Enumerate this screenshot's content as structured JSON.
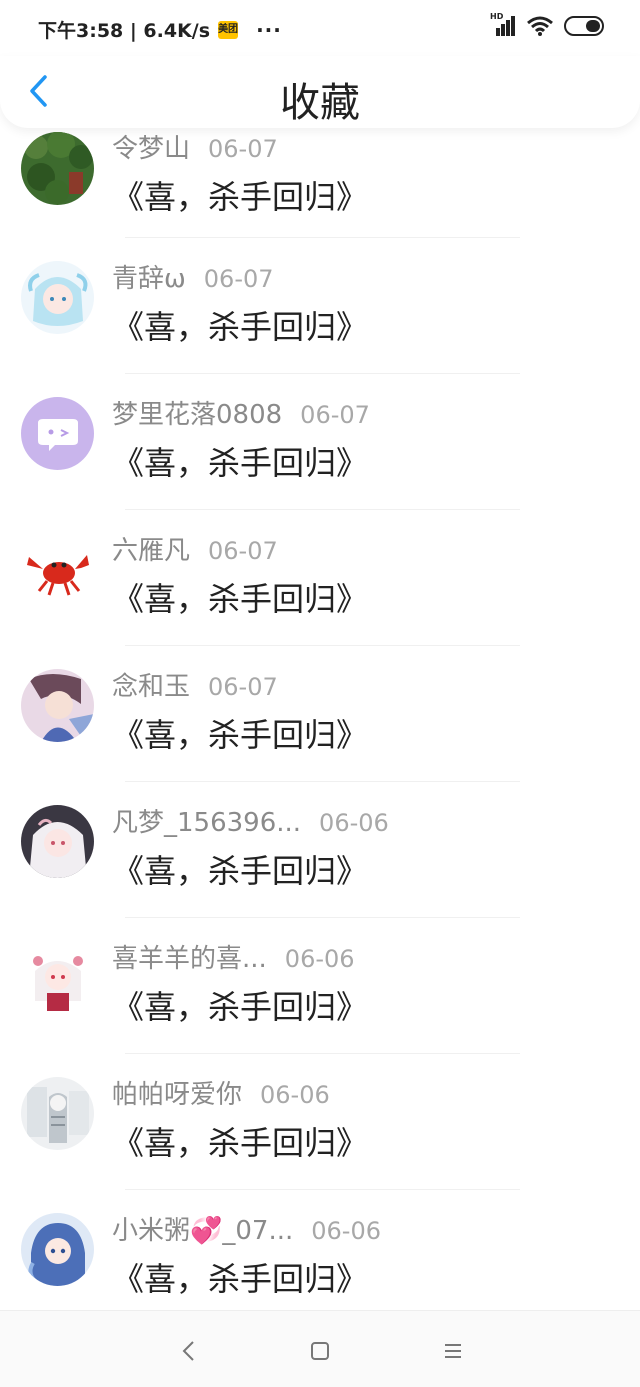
{
  "status": {
    "time_speed": "下午3:58 | 6.4K/s",
    "app_badge": "美团",
    "more": "···",
    "network": "HD"
  },
  "header": {
    "title": "收藏"
  },
  "items": [
    {
      "name": "令梦山",
      "date": "06-07",
      "content": "《喜，杀手回归》"
    },
    {
      "name": "青辞ω",
      "date": "06-07",
      "content": "《喜，杀手回归》"
    },
    {
      "name": "梦里花落0808",
      "date": "06-07",
      "content": "《喜，杀手回归》"
    },
    {
      "name": "六雁凡",
      "date": "06-07",
      "content": "《喜，杀手回归》"
    },
    {
      "name": "念和玉",
      "date": "06-07",
      "content": "《喜，杀手回归》"
    },
    {
      "name": "凡梦_156396...",
      "date": "06-06",
      "content": "《喜，杀手回归》"
    },
    {
      "name": "喜羊羊的喜...",
      "date": "06-06",
      "content": "《喜，杀手回归》"
    },
    {
      "name": "帕帕呀爱你",
      "date": "06-06",
      "content": "《喜，杀手回归》"
    },
    {
      "name": "小米粥💞_07...",
      "date": "06-06",
      "content": "《喜，杀手回归》"
    }
  ],
  "colors": {
    "accent": "#2196f3",
    "name_gray": "#8a8a8a",
    "date_gray": "#a8a8a8"
  }
}
